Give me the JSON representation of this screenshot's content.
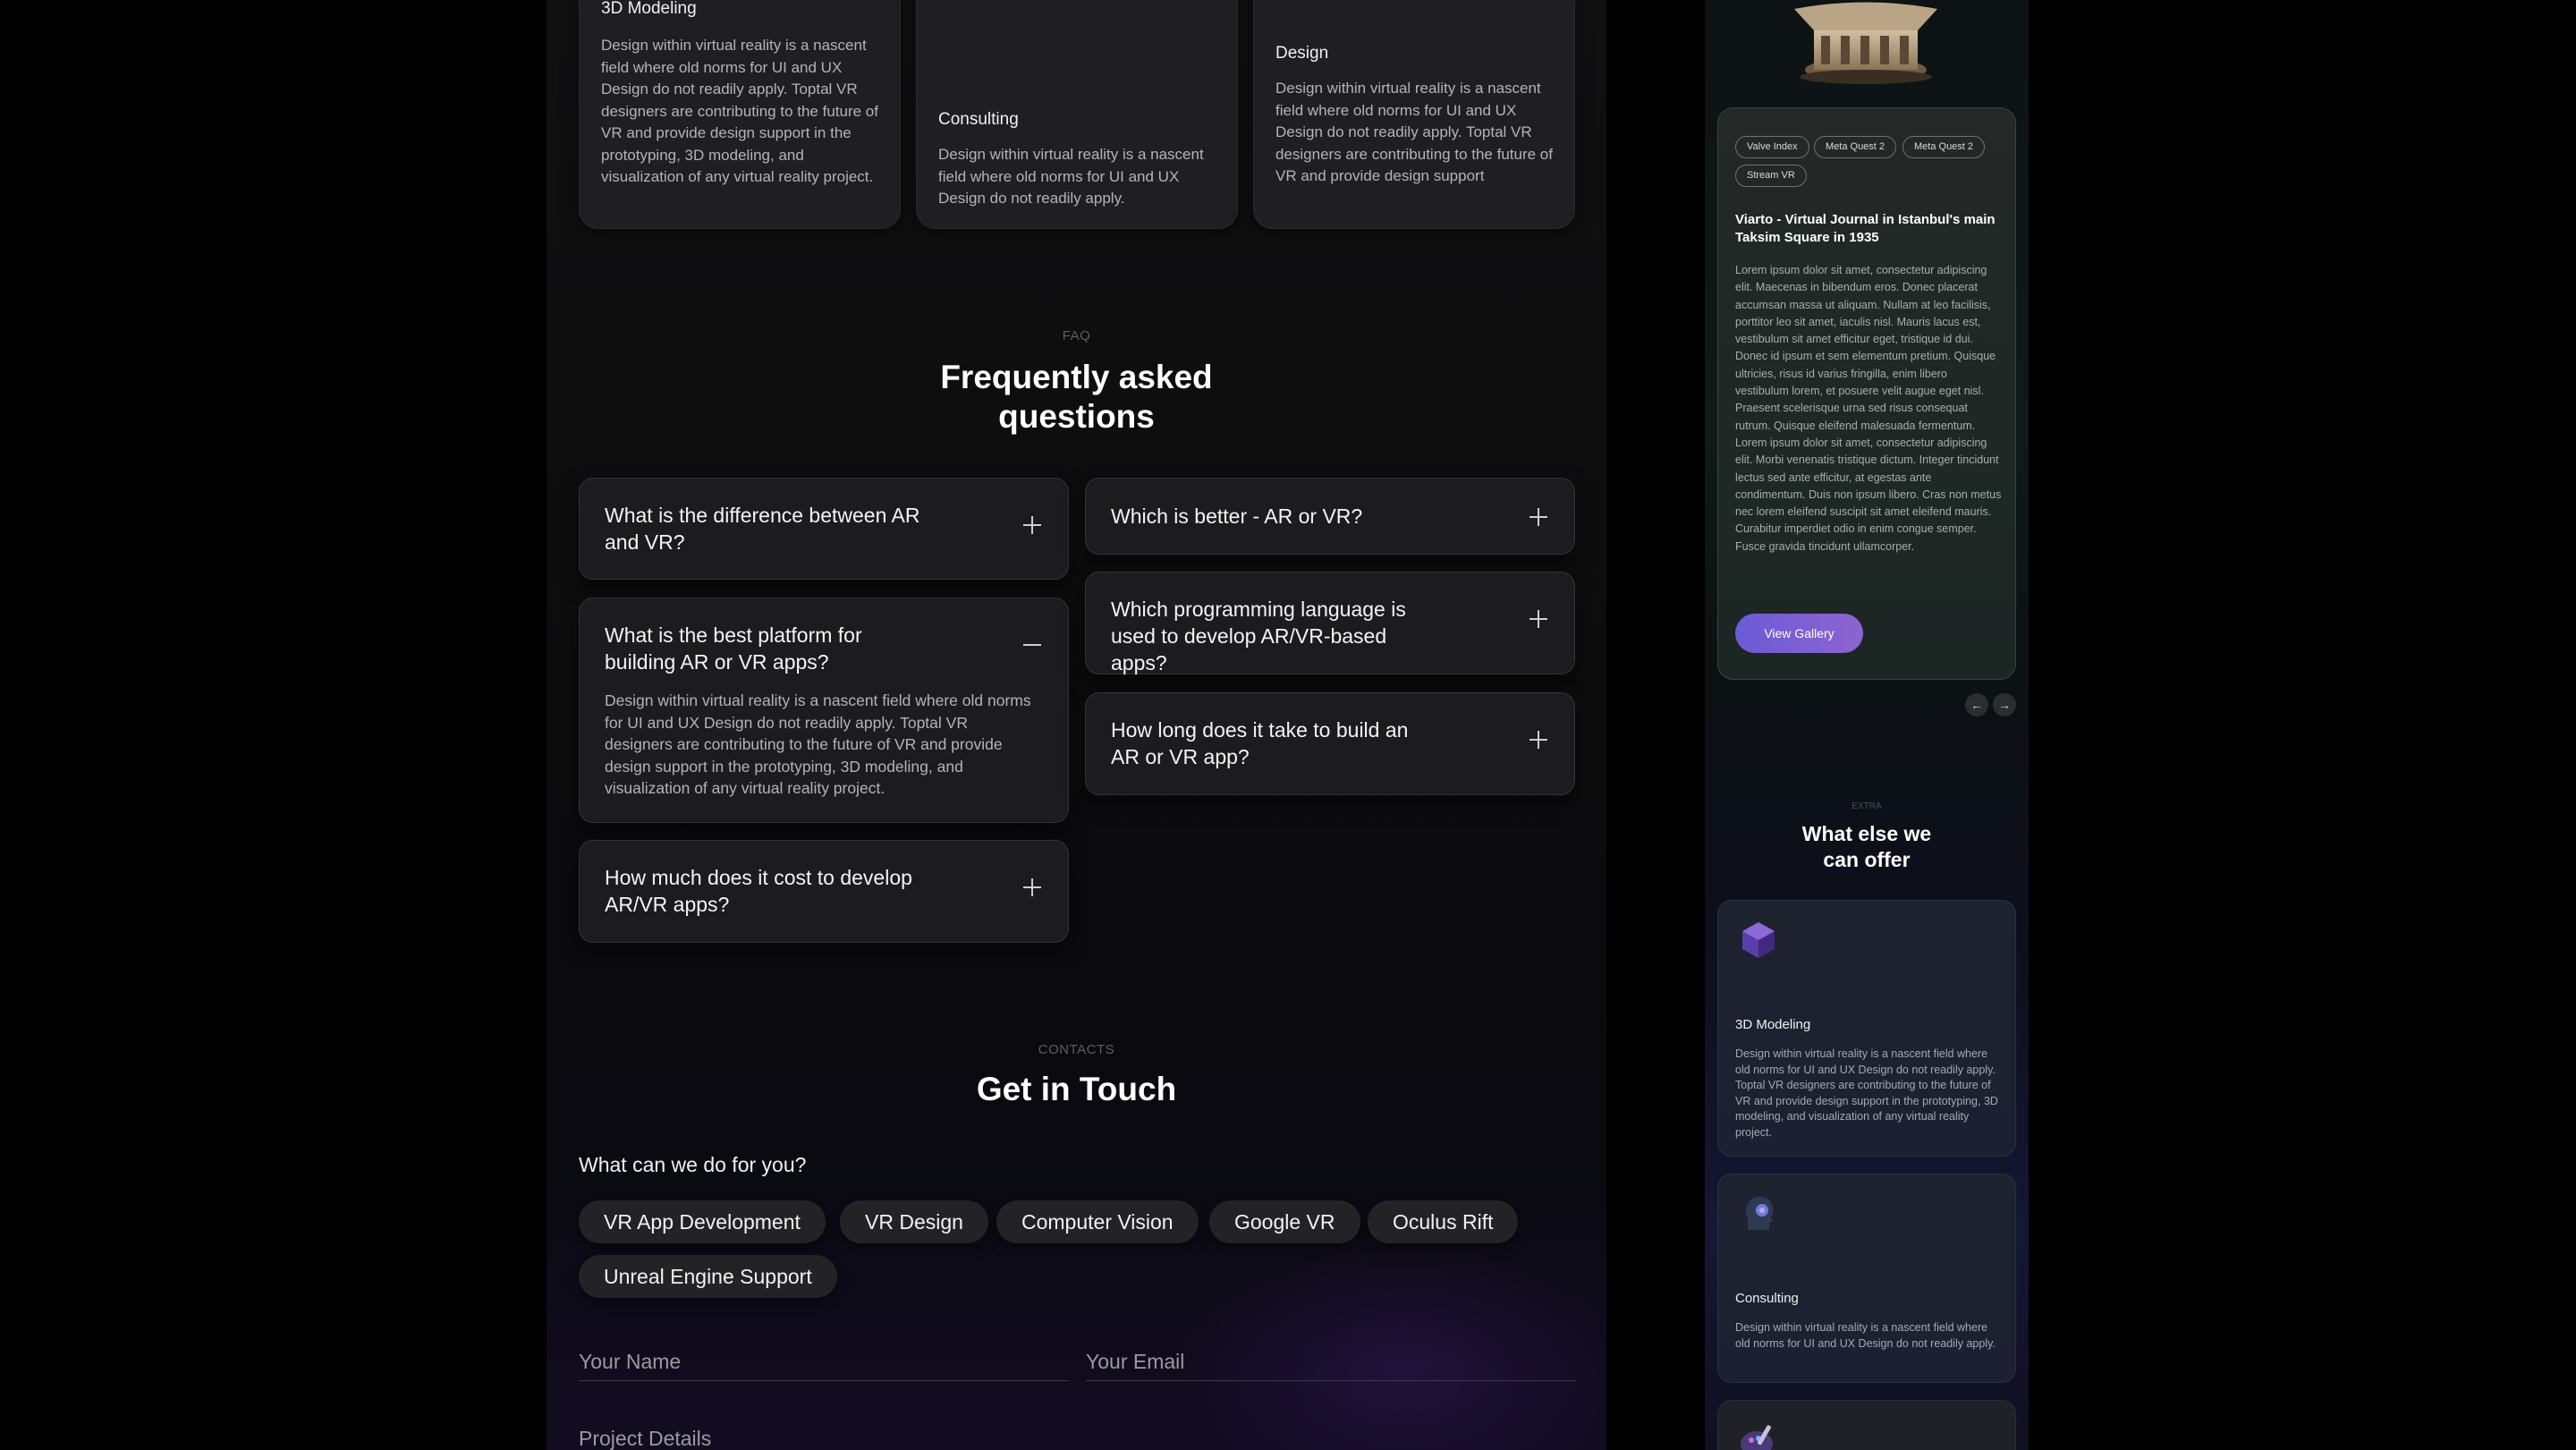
{
  "services": [
    {
      "title": "3D Modeling",
      "desc": "Design within virtual reality is a nascent field where old norms for UI and UX Design do not readily apply. Toptal VR designers are contributing to the future of VR and provide design support in the prototyping, 3D modeling, and visualization of any virtual reality project."
    },
    {
      "title": "Consulting",
      "desc": "Design within virtual reality is a nascent field where old norms for UI and UX Design do not readily apply."
    },
    {
      "title": "Design",
      "desc": "Design within virtual reality is a nascent field where old norms for UI and UX Design do not readily apply. Toptal VR designers are contributing to the future of VR and provide design support"
    }
  ],
  "faq": {
    "eyebrow": "FAQ",
    "title_line1": "Frequently asked",
    "title_line2": "questions",
    "items": [
      {
        "question": "What is the difference between AR and VR?",
        "expanded": false
      },
      {
        "question": "What is the best platform for building AR or VR apps?",
        "expanded": true,
        "answer": "Design within virtual reality is a nascent field where old norms for UI and UX Design do not readily apply. Toptal VR designers are contributing to the future of VR and provide design support in the prototyping, 3D modeling, and visualization of any virtual reality project."
      },
      {
        "question": "How much does it cost to develop AR/VR apps?",
        "expanded": false
      },
      {
        "question": "Which is better - AR or VR?",
        "expanded": false
      },
      {
        "question": "Which programming language is used to develop AR/VR-based apps?",
        "expanded": false
      },
      {
        "question": "How long does it take to build an AR or VR app?",
        "expanded": false
      }
    ]
  },
  "contacts": {
    "eyebrow": "CONTACTS",
    "title": "Get in Touch",
    "question": "What can we do for you?",
    "chips": [
      "VR App Development",
      "VR Design",
      "Computer Vision",
      "Google VR",
      "Oculus Rift",
      "Unreal Engine Support"
    ],
    "name_placeholder": "Your Name",
    "email_placeholder": "Your Email",
    "details_placeholder": "Project Details"
  },
  "gallery": {
    "tags": [
      "Valve Index",
      "Meta Quest 2",
      "Meta Quest 2",
      "Stream VR"
    ],
    "title": "Viarto - Virtual Journal in Istanbul's main Taksim Square in 1935",
    "body": "Lorem ipsum dolor sit amet, consectetur adipiscing elit. Maecenas in bibendum eros. Donec placerat accumsan massa ut aliquam. Nullam at leo facilisis, porttitor leo sit amet, iaculis nisl. Mauris lacus est, vestibulum sit amet efficitur eget, tristique id dui. Donec id ipsum et sem elementum pretium. Quisque ultricies, risus id varius fringilla, enim libero vestibulum lorem, et posuere velit augue eget nisl. Praesent scelerisque urna sed risus consequat rutrum. Quisque eleifend malesuada fermentum. Lorem ipsum dolor sit amet, consectetur adipiscing elit. Morbi venenatis tristique dictum. Integer tincidunt lectus sed ante efficitur, at egestas ante condimentum. Duis non ipsum libero. Cras non metus nec lorem eleifend suscipit sit amet eleifend mauris. Curabitur imperdiet odio in enim congue semper. Fusce gravida tincidunt ullamcorper.",
    "button": "View Gallery",
    "prev_icon": "arrow-left-icon",
    "next_icon": "arrow-right-icon"
  },
  "extra": {
    "eyebrow": "EXTRA",
    "title_line1": "What else we",
    "title_line2": "can offer",
    "items": [
      {
        "title": "3D Modeling",
        "desc": "Design within virtual reality is a nascent field where old norms for UI and UX Design do not readily apply. Toptal VR designers are contributing to the future of VR and provide design support in the prototyping, 3D modeling, and visualization of any virtual reality project.",
        "icon": "cube-icon"
      },
      {
        "title": "Consulting",
        "desc": "Design within virtual reality is a nascent field where old norms for UI and UX Design do not readily apply.",
        "icon": "head-icon"
      },
      {
        "icon": "palette-icon"
      }
    ]
  },
  "colors": {
    "accent_start": "#6c5bd6",
    "accent_end": "#8d64cf",
    "card_bg": "#1f1f21",
    "page_bg": "#000000"
  }
}
